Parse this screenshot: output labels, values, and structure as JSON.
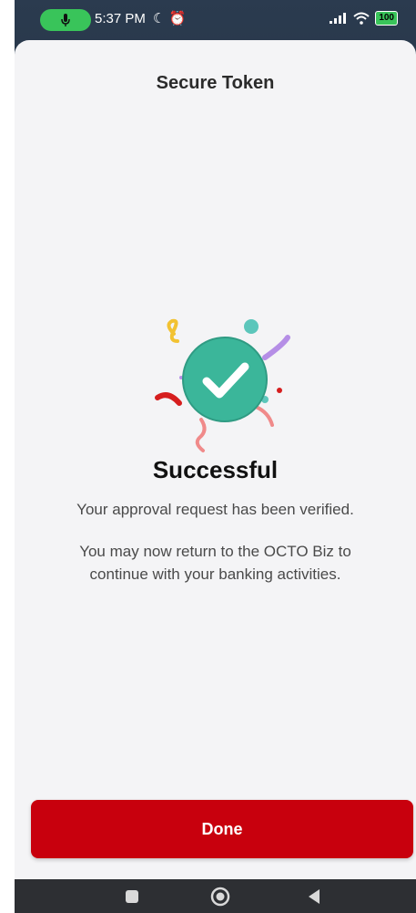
{
  "status_bar": {
    "time": "5:37 PM",
    "battery": "100"
  },
  "screen": {
    "title": "Secure Token",
    "result_title": "Successful",
    "line1": "Your approval request has been verified.",
    "line2": "You may now return to the OCTO Biz to",
    "line3": "continue with your banking activities."
  },
  "actions": {
    "done_label": "Done"
  },
  "colors": {
    "primary": "#c8000d",
    "success": "#3bb69a",
    "sheet_bg": "#f4f4f6",
    "nav_bg": "#2d2f33"
  },
  "icons": {
    "mic": "mic-icon",
    "moon": "moon-icon",
    "alarm": "alarm-icon",
    "signal": "signal-icon",
    "wifi": "wifi-icon",
    "check": "checkmark-icon",
    "nav_recents": "square-icon",
    "nav_home": "circle-icon",
    "nav_back": "triangle-back-icon"
  }
}
